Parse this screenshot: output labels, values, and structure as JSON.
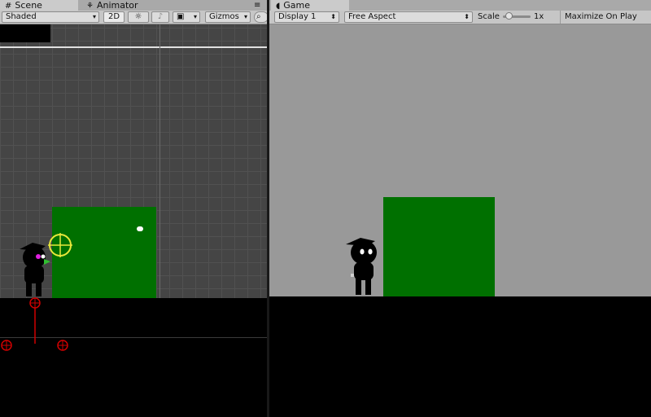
{
  "scene_panel": {
    "tabs": [
      {
        "label": "Scene",
        "icon": "hash-grid-icon"
      },
      {
        "label": "Animator",
        "icon": "animator-icon"
      }
    ],
    "menu_icon": "≡",
    "toolbar": {
      "shading_mode": "Shaded",
      "mode_2d": "2D",
      "lighting_icon": "☼",
      "audio_icon": "♪",
      "effects_icon": "▣",
      "gizmos": "Gizmos"
    }
  },
  "game_panel": {
    "tab": {
      "label": "Game",
      "icon": "pacman-icon"
    },
    "toolbar": {
      "display": "Display 1",
      "aspect": "Free Aspect",
      "scale_label": "Scale",
      "scale_value": "1x",
      "scale_fraction": 0.1,
      "maximize": "Maximize On Play"
    }
  },
  "colors": {
    "grid_bg": "#454545",
    "game_bg": "#999999",
    "green_block": "#007000",
    "ground": "#000000",
    "gizmo_red": "#d00000",
    "gizmo_yellow": "#e8e83a"
  }
}
